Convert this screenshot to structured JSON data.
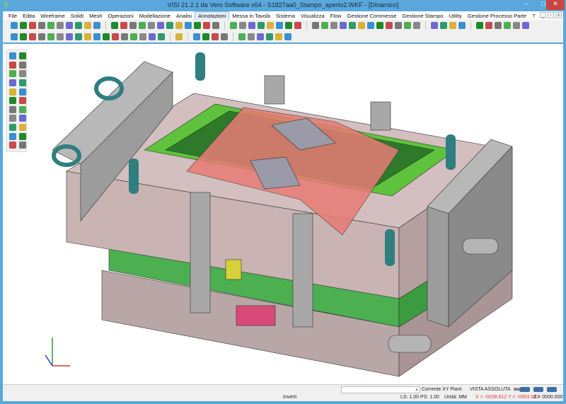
{
  "window": {
    "title": "VISI 21.2.1 da Vero Software x64 - S1827aa0_Stampo_aperto2.WKF - [Dinamico]",
    "app_icon": "V",
    "minimize": "–",
    "maximize": "□",
    "close": "✕"
  },
  "menu": [
    "File",
    "Edita",
    "Wireframe",
    "Solidi",
    "Mesh",
    "Operazioni",
    "Modellazione",
    "Analisi",
    "Annotazioni",
    "Messa in Tavola",
    "Sistema",
    "Visualizza",
    "Flow",
    "Gestione Commesse",
    "Gestione Stampo",
    "Utility",
    "Gestione Processo Parte",
    "?"
  ],
  "active_menu": "Annotazioni",
  "mdi_controls": [
    "_",
    "▫",
    "x"
  ],
  "status": {
    "search_placeholder": "",
    "search_icon": "⌕",
    "plane": "Corrente XY Piant",
    "view": "VISTA ASSOLUTA",
    "layer": "sup02",
    "invert": "Inverti",
    "ls_ps": "LS: 1.00 PS: 1.00",
    "units": "Unità: MM",
    "coords_xy": "X = -0238.812 Y = -0903.643",
    "coords_z": "Z = 0000.000"
  },
  "colors": {
    "accent": "#5aa7dc",
    "plate": "#c9b3b3",
    "core": "#2f7a2a",
    "insert": "#e87b74",
    "rail": "#9c9c9c",
    "green_plate": "#4caf50",
    "pin": "#2f7f80"
  }
}
